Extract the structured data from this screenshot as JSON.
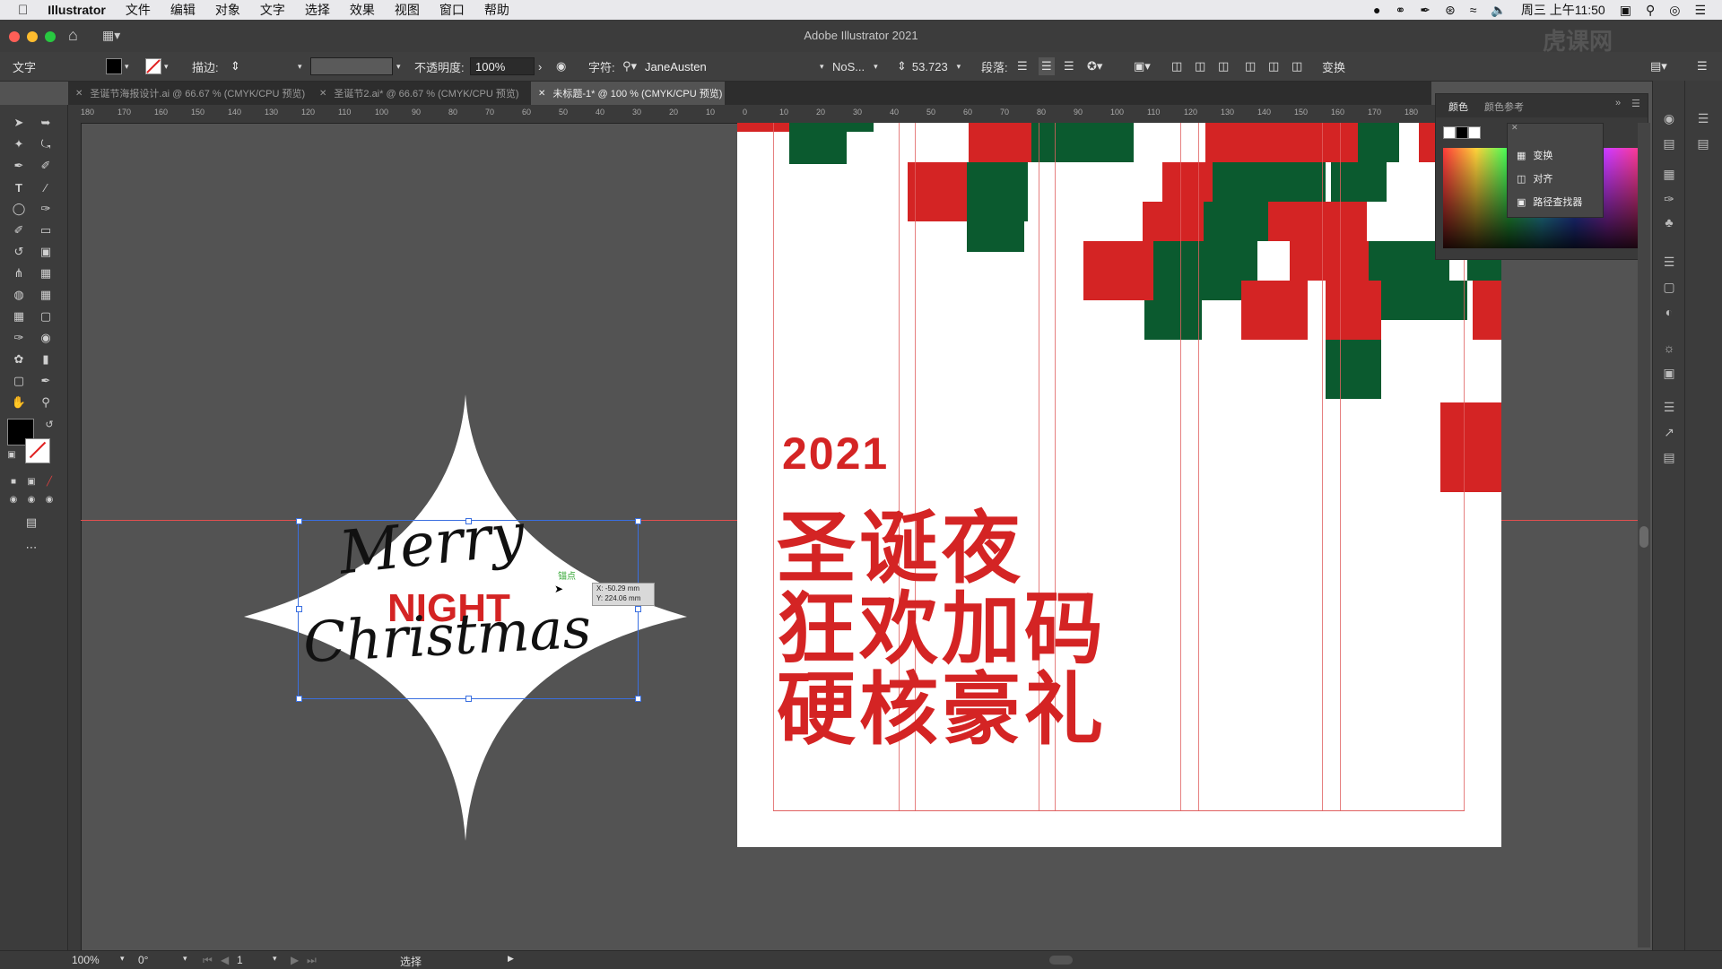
{
  "menubar": {
    "app": "Illustrator",
    "items": [
      "文件",
      "编辑",
      "对象",
      "文字",
      "选择",
      "效果",
      "视图",
      "窗口",
      "帮助"
    ],
    "clock": "周三 上午11:50"
  },
  "window": {
    "title": "Adobe Illustrator 2021"
  },
  "control": {
    "tool_label": "文字",
    "stroke_label": "描边:",
    "opacity_label": "不透明度:",
    "opacity_value": "100%",
    "char_label": "字符:",
    "font_name": "JaneAusten",
    "font_style": "NoS...",
    "font_size": "53.723",
    "para_label": "段落:",
    "transform_label": "变换"
  },
  "tabs": [
    {
      "label": "圣诞节海报设计.ai @ 66.67 % (CMYK/CPU 预览)"
    },
    {
      "label": "圣诞节2.ai* @ 66.67 % (CMYK/CPU 预览)"
    },
    {
      "label": "未标题-1* @ 100 % (CMYK/CPU 预览)"
    }
  ],
  "ruler": {
    "ticks_h": [
      "180",
      "170",
      "160",
      "150",
      "140",
      "130",
      "120",
      "110",
      "100",
      "90",
      "80",
      "70",
      "60",
      "50",
      "40",
      "30",
      "20",
      "10",
      "0",
      "10",
      "20",
      "30",
      "40",
      "50",
      "60",
      "70",
      "80",
      "90",
      "100",
      "110",
      "120",
      "130",
      "140",
      "150",
      "160",
      "170",
      "180"
    ]
  },
  "canvas": {
    "merry": "Merry",
    "night": "NIGHT",
    "christmas": "Christmas",
    "anchor_label": "锚点",
    "tooltip_x": "X: -50.29 mm",
    "tooltip_y": "Y: 224.06 mm"
  },
  "poster": {
    "year": "2021",
    "line1": "圣诞夜",
    "line2": "狂欢加码",
    "line3": "硬核豪礼",
    "red": "#d42424",
    "green": "#0b5a2f"
  },
  "panels": {
    "color_tab": "颜色",
    "color_guide_tab": "颜色参考",
    "menu_items": [
      "变换",
      "对齐",
      "路径查找器"
    ]
  },
  "status": {
    "zoom": "100%",
    "rotation": "0°",
    "page": "1",
    "mode": "选择"
  },
  "watermark": "虎课网"
}
